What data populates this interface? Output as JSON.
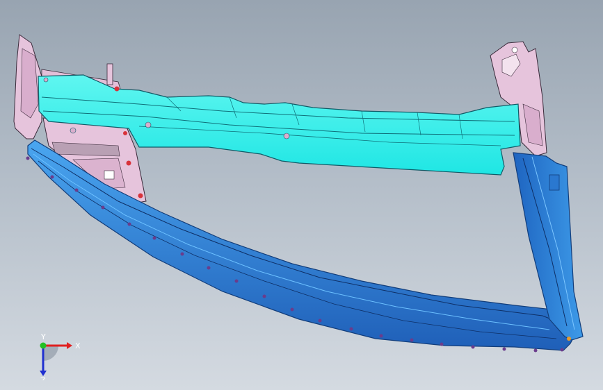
{
  "viewport": {
    "background_top": "#98a4b1",
    "background_bottom": "#d4dae1"
  },
  "model": {
    "parts": [
      {
        "name": "cross-member-beam",
        "color": "#2ef2ea"
      },
      {
        "name": "inner-panel",
        "color": "#e6c4dc"
      },
      {
        "name": "side-rail",
        "color": "#2f86dd"
      },
      {
        "name": "pillar-rail",
        "color": "#2f86dd"
      },
      {
        "name": "bracket-markers",
        "color": "#d8323a"
      },
      {
        "name": "fastener-clips",
        "color": "#6a3c8c"
      }
    ]
  },
  "triad": {
    "x_label": "X",
    "y_label": "Y",
    "z_label": "Z",
    "x_color": "#e02020",
    "y_color": "#22c022",
    "z_color": "#2030d0"
  }
}
